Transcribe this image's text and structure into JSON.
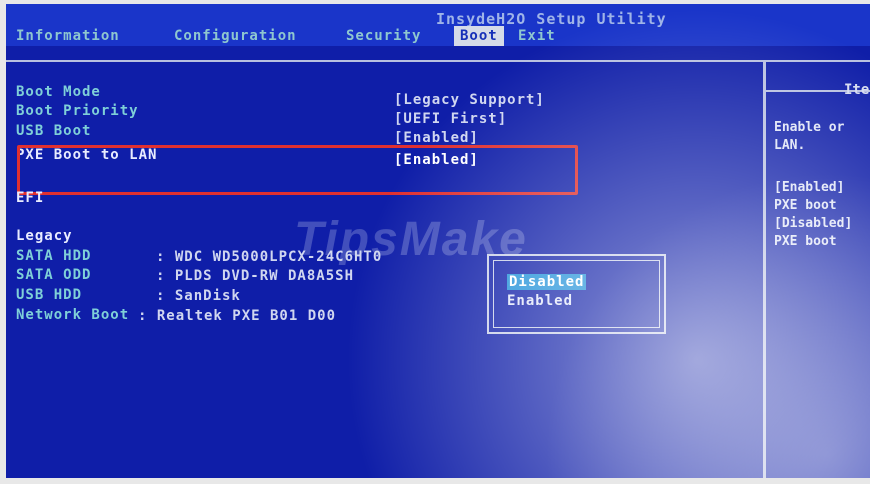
{
  "app_title": "InsydeH2O Setup Utility",
  "menu": [
    "Information",
    "Configuration",
    "Security",
    "Boot",
    "Exit"
  ],
  "active_menu": "Boot",
  "help": {
    "title": "Ite",
    "lines": [
      "Enable or",
      "LAN.",
      "",
      "[Enabled]",
      "PXE boot",
      "[Disabled]",
      "PXE boot"
    ]
  },
  "settings": [
    {
      "label": "Boot Mode",
      "value": "[Legacy Support]"
    },
    {
      "label": "Boot Priority",
      "value": "[UEFI First]"
    },
    {
      "label": "USB Boot",
      "value": "[Enabled]"
    },
    {
      "label": "PXE Boot to LAN",
      "value": "[Enabled]"
    }
  ],
  "efi_label": "EFI",
  "legacy": {
    "heading": "Legacy",
    "devices": [
      {
        "label": "SATA HDD",
        "value": ": WDC WD5000LPCX-24C6HT0"
      },
      {
        "label": "SATA ODD",
        "value": ": PLDS    DVD-RW DA8A5SH"
      },
      {
        "label": "USB HDD",
        "value": ": SanDisk"
      },
      {
        "label": "Network Boot",
        "value": ": Realtek PXE B01 D00"
      }
    ]
  },
  "popup": {
    "options": [
      "Disabled",
      "Enabled"
    ],
    "selected": "Disabled"
  },
  "watermark": "TipsMake",
  "colors": {
    "bios_blue": "#0f1ea8",
    "highlight_red": "#e03030",
    "selected_option": "#1d8fd8"
  }
}
